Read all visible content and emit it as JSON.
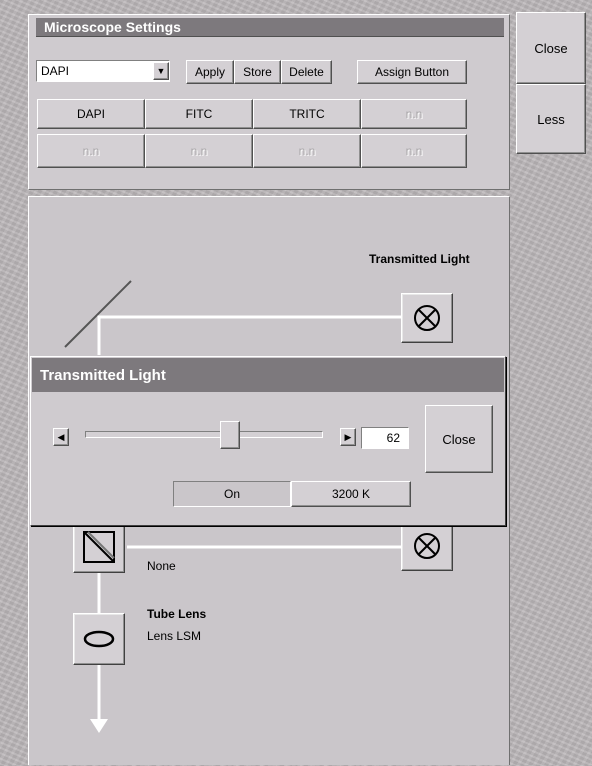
{
  "microscope_settings": {
    "title": "Microscope Settings",
    "preset_select": "DAPI",
    "apply_label": "Apply",
    "store_label": "Store",
    "delete_label": "Delete",
    "assign_label": "Assign Button",
    "preset_buttons_row1": [
      "DAPI",
      "FITC",
      "TRITC",
      "n.n"
    ],
    "preset_buttons_row2": [
      "n.n",
      "n.n",
      "n.n",
      "n.n"
    ]
  },
  "side": {
    "close_label": "Close",
    "less_label": "Less"
  },
  "diagram": {
    "transmitted_light_label": "Transmitted Light",
    "reflector_value": "None",
    "tube_lens_label": "Tube Lens",
    "tube_lens_value": "Lens LSM"
  },
  "transmitted_dialog": {
    "title": "Transmitted Light",
    "slider_value": "62",
    "slider_fraction": 0.62,
    "close_label": "Close",
    "on_label": "On",
    "temperature_label": "3200 K"
  }
}
